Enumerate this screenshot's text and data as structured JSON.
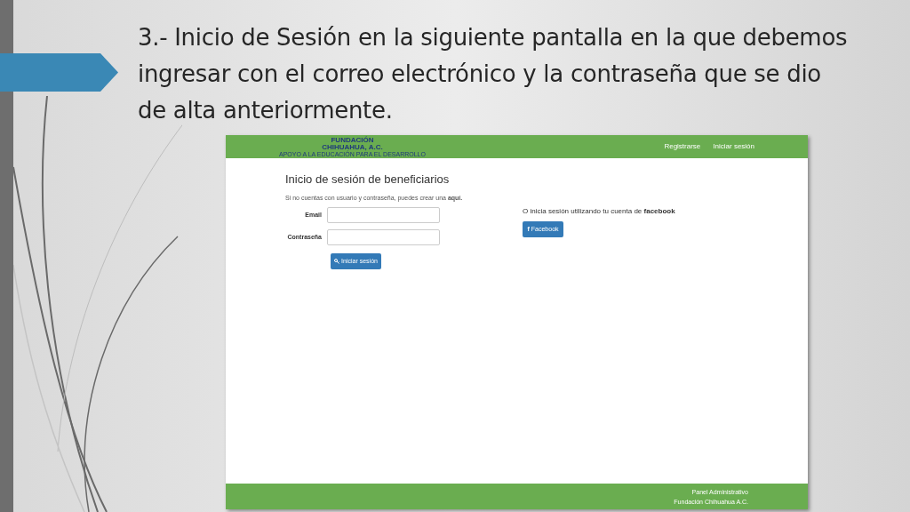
{
  "slide": {
    "title": "3.- Inicio de Sesión en la siguiente pantalla en la que debemos ingresar con el correo electrónico y la contraseña que se dio de alta anteriormente."
  },
  "screenshot": {
    "navbar": {
      "logo_lines": [
        "FUNDACIÓN",
        "CHIHUAHUA, A.C."
      ],
      "logo_tagline": "APOYO A LA EDUCACIÓN PARA EL DESARROLLO",
      "links": [
        "Registrarse",
        "Iniciar sesión"
      ]
    },
    "login": {
      "heading": "Inicio de sesión de beneficiarios",
      "intro": "Si no cuentas con usuario y contraseña, puedes crear una **aquí.**",
      "fields": [
        {
          "label": "Email"
        },
        {
          "label": "Contraseña"
        }
      ],
      "submit": "Iniciar sesión"
    },
    "social": {
      "text": "O inicia sesión utilizando tu cuenta de **facebook**",
      "button_icon": "f",
      "button": "Facebook"
    },
    "footer": [
      "Panel Administrativo",
      "Fundación Chihuahua A.C."
    ]
  }
}
